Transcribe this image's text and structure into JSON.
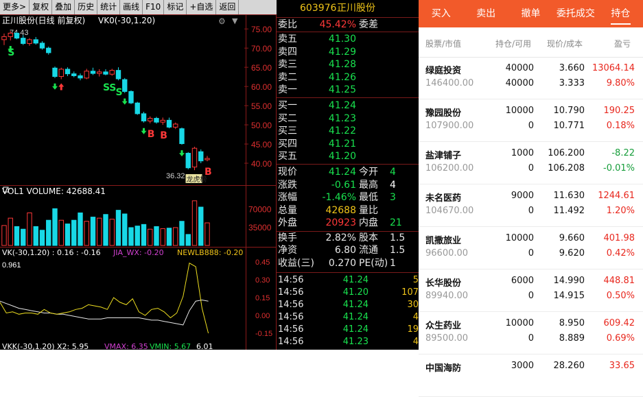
{
  "toolbar": {
    "items": [
      "更多>",
      "复权",
      "叠加",
      "历史",
      "统计",
      "画线",
      "F10",
      "标记",
      "+自选",
      "返回"
    ]
  },
  "chart": {
    "title": "正川股份(日线 前复权)",
    "indicator": "VK0(-30,1.20)",
    "high_label": "74.43",
    "low_label": "36.32",
    "price_axis": [
      "75.00",
      "70.00",
      "65.00",
      "60.00",
      "55.00",
      "50.00",
      "45.00",
      "40.00"
    ],
    "signal_markers": [
      "S",
      "S",
      "S",
      "S",
      "B",
      "B",
      "B"
    ],
    "badge": "龙虎榜",
    "vol_title": "VOL1  VOLUME: 42688.41",
    "vol_axis": [
      "70000",
      "35000"
    ],
    "vk_info": [
      "VK(-30,1.20) : 0.16 : -0.16",
      "JIA_WX: -0.20",
      "NEWLB888: -0.20"
    ],
    "vk_value": "0.961",
    "vk_axis": [
      "0.45",
      "0.30",
      "0.15",
      "0.00",
      "-0.15"
    ],
    "vkk_info": [
      "VKK(-30,1.20)  X2: 5.95",
      "VMAX: 6.35",
      "VMIN: 5.67",
      "6.01"
    ]
  },
  "chart_data": {
    "type": "candlestick",
    "series": [
      {
        "o": 72.2,
        "h": 73.8,
        "l": 70.8,
        "c": 73.0
      },
      {
        "o": 73.0,
        "h": 74.43,
        "l": 72.0,
        "c": 73.9
      },
      {
        "o": 73.9,
        "h": 74.2,
        "l": 72.3,
        "c": 72.6
      },
      {
        "o": 72.6,
        "h": 73.4,
        "l": 70.8,
        "c": 71.2
      },
      {
        "o": 71.2,
        "h": 72.6,
        "l": 70.6,
        "c": 72.2
      },
      {
        "o": 72.2,
        "h": 72.9,
        "l": 70.9,
        "c": 71.3
      },
      {
        "o": 71.3,
        "h": 71.8,
        "l": 69.6,
        "c": 70.0
      },
      {
        "o": 70.0,
        "h": 70.4,
        "l": 68.3,
        "c": 68.8
      },
      {
        "o": 64.8,
        "h": 65.2,
        "l": 62.2,
        "c": 62.6
      },
      {
        "o": 62.6,
        "h": 64.9,
        "l": 61.9,
        "c": 64.5
      },
      {
        "o": 64.5,
        "h": 65.0,
        "l": 62.7,
        "c": 63.3
      },
      {
        "o": 63.3,
        "h": 63.9,
        "l": 62.4,
        "c": 62.8
      },
      {
        "o": 62.8,
        "h": 63.4,
        "l": 61.6,
        "c": 62.2
      },
      {
        "o": 62.2,
        "h": 64.6,
        "l": 61.9,
        "c": 64.0
      },
      {
        "o": 64.0,
        "h": 64.9,
        "l": 63.0,
        "c": 63.4
      },
      {
        "o": 63.4,
        "h": 64.5,
        "l": 62.6,
        "c": 63.8
      },
      {
        "o": 63.8,
        "h": 64.5,
        "l": 62.9,
        "c": 63.2
      },
      {
        "o": 63.2,
        "h": 64.6,
        "l": 62.8,
        "c": 64.2
      },
      {
        "o": 64.2,
        "h": 65.0,
        "l": 61.6,
        "c": 62.0
      },
      {
        "o": 61.8,
        "h": 62.2,
        "l": 58.3,
        "c": 58.7
      },
      {
        "o": 58.7,
        "h": 59.0,
        "l": 55.4,
        "c": 55.7
      },
      {
        "o": 55.7,
        "h": 56.0,
        "l": 52.6,
        "c": 52.9
      },
      {
        "o": 52.9,
        "h": 53.4,
        "l": 50.6,
        "c": 51.0
      },
      {
        "o": 51.0,
        "h": 52.2,
        "l": 50.4,
        "c": 51.7
      },
      {
        "o": 51.7,
        "h": 52.1,
        "l": 50.3,
        "c": 50.7
      },
      {
        "o": 50.7,
        "h": 51.9,
        "l": 50.0,
        "c": 51.2
      },
      {
        "o": 51.2,
        "h": 51.9,
        "l": 49.1,
        "c": 49.4
      },
      {
        "o": 49.4,
        "h": 50.6,
        "l": 48.9,
        "c": 50.2
      },
      {
        "o": 49.0,
        "h": 49.3,
        "l": 44.8,
        "c": 45.1
      },
      {
        "o": 42.6,
        "h": 42.9,
        "l": 38.4,
        "c": 38.8
      },
      {
        "o": 39.0,
        "h": 44.3,
        "l": 38.2,
        "c": 43.9
      },
      {
        "o": 43.0,
        "h": 43.6,
        "l": 40.0,
        "c": 40.6
      },
      {
        "o": 40.9,
        "h": 41.9,
        "l": 40.5,
        "c": 41.24
      }
    ],
    "volume": [
      38000,
      52000,
      36000,
      31000,
      62000,
      36000,
      29000,
      48000,
      70000,
      48000,
      41000,
      48000,
      62000,
      46000,
      54000,
      52000,
      59000,
      50000,
      67000,
      60000,
      34000,
      37000,
      40000,
      31000,
      36000,
      32000,
      33000,
      34000,
      46000,
      21000,
      85000,
      73000,
      43000
    ],
    "ylim": [
      35,
      77
    ],
    "vol_ylim": [
      0,
      90000
    ]
  },
  "quote": {
    "code": "603976",
    "name": "正川股份",
    "weibi_label": "委比",
    "weibi": "45.42%",
    "weicha_label": "委差",
    "asks": [
      {
        "label": "卖五",
        "price": "41.30"
      },
      {
        "label": "卖四",
        "price": "41.29"
      },
      {
        "label": "卖三",
        "price": "41.28"
      },
      {
        "label": "卖二",
        "price": "41.26"
      },
      {
        "label": "卖一",
        "price": "41.25"
      }
    ],
    "bids": [
      {
        "label": "买一",
        "price": "41.24"
      },
      {
        "label": "买二",
        "price": "41.23"
      },
      {
        "label": "买三",
        "price": "41.22"
      },
      {
        "label": "买四",
        "price": "41.21"
      },
      {
        "label": "买五",
        "price": "41.20"
      }
    ],
    "stats": [
      {
        "l1": "现价",
        "v1": "41.24",
        "c1": "#19e24f",
        "l2": "今开",
        "v2": "4",
        "c2": "#19e24f"
      },
      {
        "l1": "涨跌",
        "v1": "-0.61",
        "c1": "#19e24f",
        "l2": "最高",
        "v2": "4",
        "c2": "#ffffff"
      },
      {
        "l1": "涨幅",
        "v1": "-1.46%",
        "c1": "#19e24f",
        "l2": "最低",
        "v2": "3",
        "c2": "#19e24f"
      },
      {
        "l1": "总量",
        "v1": "42688",
        "c1": "#f0c419",
        "l2": "量比",
        "v2": "",
        "c2": "#ffffff"
      },
      {
        "l1": "外盘",
        "v1": "20923",
        "c1": "#ff3838",
        "l2": "内盘",
        "v2": "21",
        "c2": "#19e24f"
      },
      {
        "l1": "换手",
        "v1": "2.82%",
        "c1": "#e8e8e8",
        "l2": "股本",
        "v2": "1.5",
        "c2": "#e8e8e8"
      },
      {
        "l1": "净资",
        "v1": "6.80",
        "c1": "#e8e8e8",
        "l2": "流通",
        "v2": "1.5",
        "c2": "#e8e8e8"
      },
      {
        "l1": "收益(三)",
        "v1": "0.270",
        "c1": "#e8e8e8",
        "l2": "PE(动)",
        "v2": "1",
        "c2": "#e8e8e8"
      }
    ],
    "ticks": [
      {
        "time": "14:56",
        "price": "41.24",
        "vol": "5"
      },
      {
        "time": "14:56",
        "price": "41.20",
        "vol": "107"
      },
      {
        "time": "14:56",
        "price": "41.24",
        "vol": "30"
      },
      {
        "time": "14:56",
        "price": "41.24",
        "vol": "4"
      },
      {
        "time": "14:56",
        "price": "41.24",
        "vol": "19"
      },
      {
        "time": "14:56",
        "price": "41.23",
        "vol": "4"
      }
    ]
  },
  "tabs": [
    {
      "label": "买入",
      "active": false
    },
    {
      "label": "卖出",
      "active": false
    },
    {
      "label": "撤单",
      "active": false
    },
    {
      "label": "委托成交",
      "active": false
    },
    {
      "label": "持仓",
      "active": true
    }
  ],
  "table_header": {
    "c1": "股票/市值",
    "c2": "持仓/可用",
    "c3": "现价/成本",
    "c4": "盈亏"
  },
  "holdings": [
    {
      "name": "绿庭投资",
      "value": "146400.00",
      "hold": "40000",
      "avail": "40000",
      "price": "3.660",
      "cost": "3.333",
      "pl": "13064.14",
      "pct": "9.80%",
      "dir": "pos"
    },
    {
      "name": "豫园股份",
      "value": "107900.00",
      "hold": "10000",
      "avail": "0",
      "price": "10.790",
      "cost": "10.771",
      "pl": "190.25",
      "pct": "0.18%",
      "dir": "pos"
    },
    {
      "name": "盐津铺子",
      "value": "106200.00",
      "hold": "1000",
      "avail": "0",
      "price": "106.200",
      "cost": "106.208",
      "pl": "-8.22",
      "pct": "-0.01%",
      "dir": "neg"
    },
    {
      "name": "未名医药",
      "value": "104670.00",
      "hold": "9000",
      "avail": "0",
      "price": "11.630",
      "cost": "11.492",
      "pl": "1244.61",
      "pct": "1.20%",
      "dir": "pos"
    },
    {
      "name": "凯撒旅业",
      "value": "96600.00",
      "hold": "10000",
      "avail": "0",
      "price": "9.660",
      "cost": "9.620",
      "pl": "401.98",
      "pct": "0.42%",
      "dir": "pos"
    },
    {
      "name": "长华股份",
      "value": "89940.00",
      "hold": "6000",
      "avail": "0",
      "price": "14.990",
      "cost": "14.915",
      "pl": "448.81",
      "pct": "0.50%",
      "dir": "pos"
    },
    {
      "name": "众生药业",
      "value": "89500.00",
      "hold": "10000",
      "avail": "0",
      "price": "8.950",
      "cost": "8.889",
      "pl": "609.42",
      "pct": "0.69%",
      "dir": "pos"
    },
    {
      "name": "中国海防",
      "value": "",
      "hold": "3000",
      "avail": "",
      "price": "28.260",
      "cost": "",
      "pl": "33.65",
      "pct": "",
      "dir": "pos"
    }
  ],
  "colors": {
    "up": "#ff3838",
    "down": "#18d8e6",
    "tabbar": "#f25a2a",
    "gain": "#e8271d",
    "loss": "#169d3a"
  }
}
